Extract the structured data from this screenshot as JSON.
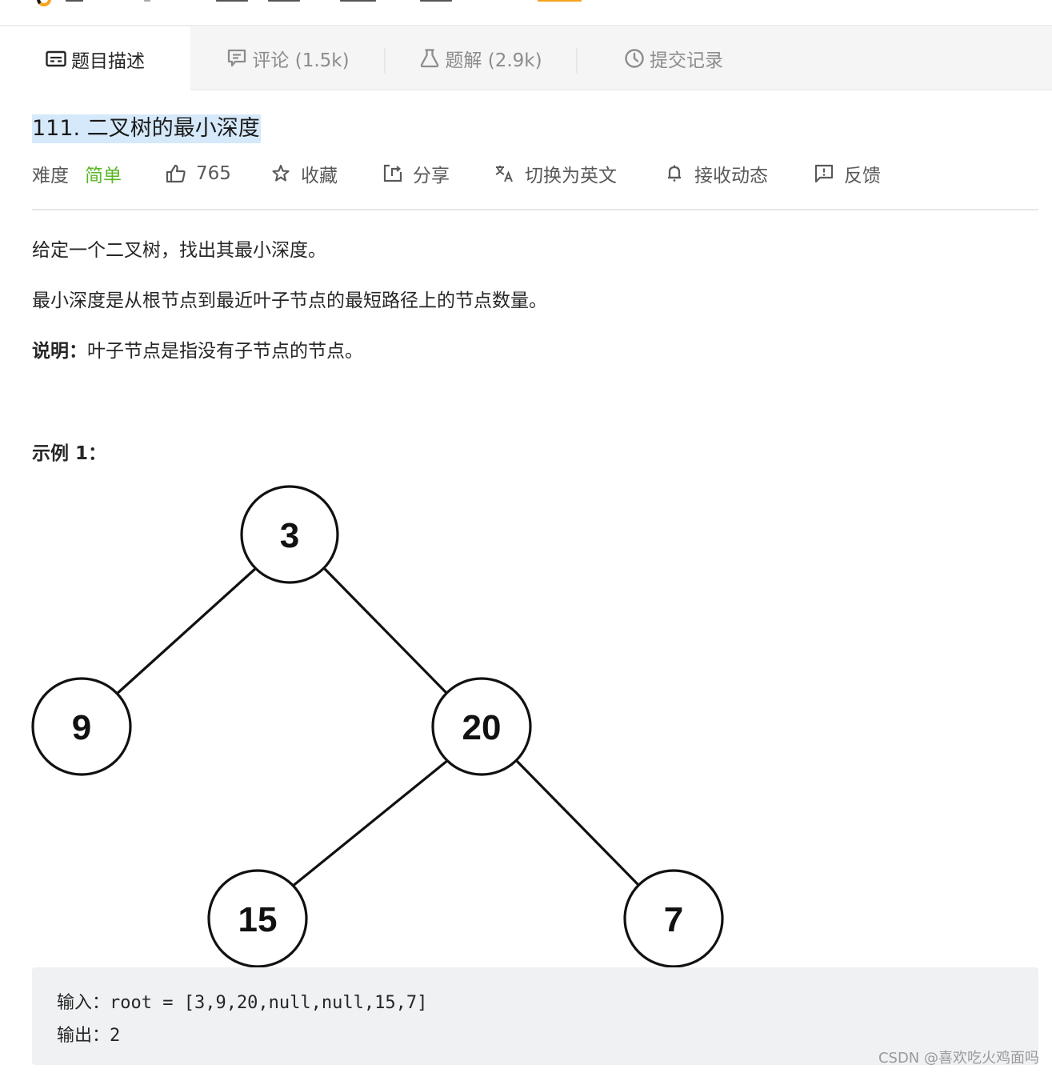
{
  "tabs": [
    {
      "label": "题目描述",
      "icon": "description-icon",
      "active": true
    },
    {
      "label": "评论 (1.5k)",
      "icon": "comment-icon",
      "active": false
    },
    {
      "label": "题解 (2.9k)",
      "icon": "flask-icon",
      "active": false
    },
    {
      "label": "提交记录",
      "icon": "clock-icon",
      "active": false
    }
  ],
  "problem": {
    "title": "111. 二叉树的最小深度",
    "difficulty_label": "难度",
    "difficulty_value": "简单",
    "likes": "765",
    "actions": {
      "favorite": "收藏",
      "share": "分享",
      "switch_language": "切换为英文",
      "subscribe": "接收动态",
      "feedback": "反馈"
    },
    "description": {
      "line1": "给定一个二叉树，找出其最小深度。",
      "line2": "最小深度是从根节点到最近叶子节点的最短路径上的节点数量。",
      "note_label": "说明：",
      "note_text": "叶子节点是指没有子节点的节点。"
    },
    "example": {
      "label": "示例 1：",
      "tree_nodes": [
        "3",
        "9",
        "20",
        "15",
        "7"
      ],
      "input": "输入：root = [3,9,20,null,null,15,7]",
      "output": "输出：2"
    }
  },
  "colors": {
    "easy": "#5ab726",
    "title_highlight": "#d6e9fb",
    "tab_bar_bg": "#f5f5f5",
    "code_bg": "#f0f1f3"
  },
  "watermark": "CSDN @喜欢吃火鸡面吗"
}
